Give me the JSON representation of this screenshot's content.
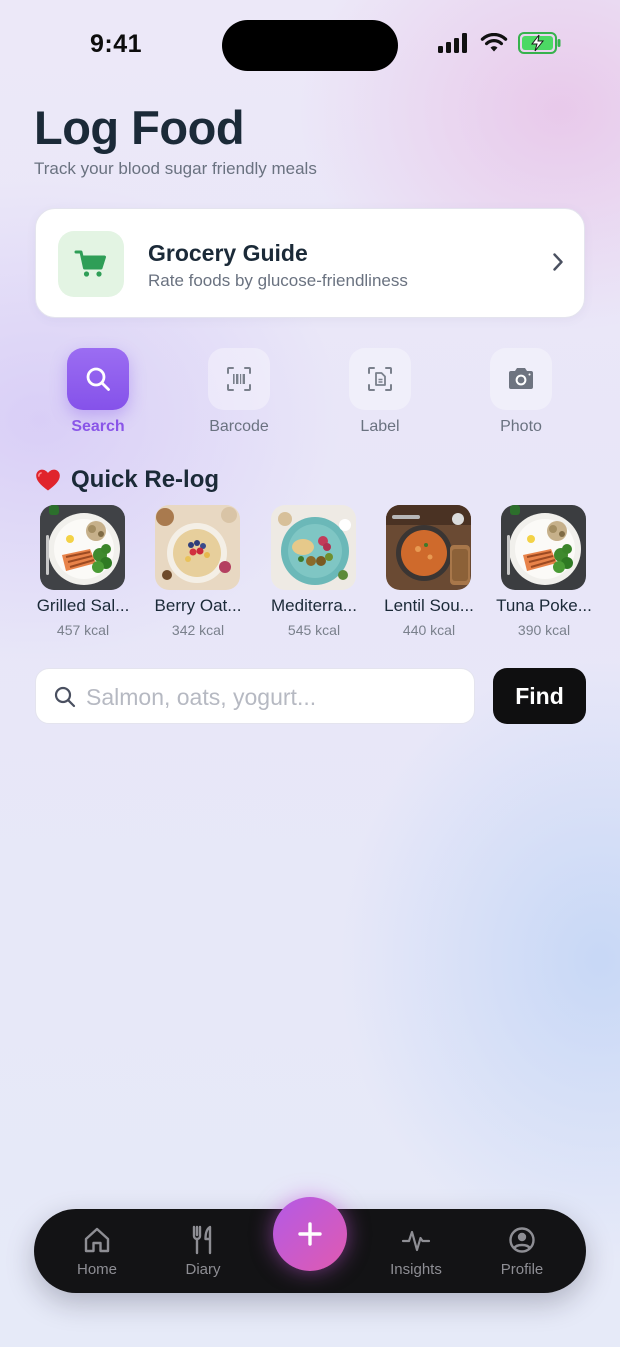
{
  "status_bar": {
    "time": "9:41"
  },
  "header": {
    "title": "Log Food",
    "subtitle": "Track your blood sugar friendly meals"
  },
  "grocery_card": {
    "title": "Grocery Guide",
    "subtitle": "Rate foods by glucose-friendliness",
    "icon": "cart-icon",
    "accent": "#2f9e57"
  },
  "modes": [
    {
      "label": "Search",
      "icon": "search-icon",
      "active": true
    },
    {
      "label": "Barcode",
      "icon": "barcode-icon",
      "active": false
    },
    {
      "label": "Label",
      "icon": "label-scan-icon",
      "active": false
    },
    {
      "label": "Photo",
      "icon": "camera-icon",
      "active": false
    }
  ],
  "quick_relog": {
    "title": "Quick Re-log",
    "icon": "heart-icon",
    "items": [
      {
        "name": "Grilled Sal...",
        "kcal": "457 kcal"
      },
      {
        "name": "Berry Oat...",
        "kcal": "342 kcal"
      },
      {
        "name": "Mediterra...",
        "kcal": "545 kcal"
      },
      {
        "name": "Lentil Sou...",
        "kcal": "440 kcal"
      },
      {
        "name": "Tuna Poke...",
        "kcal": "390 kcal"
      }
    ]
  },
  "search": {
    "placeholder": "Salmon, oats, yogurt...",
    "value": "",
    "button_label": "Find"
  },
  "bottom_nav": {
    "items": [
      {
        "label": "Home",
        "icon": "home-icon"
      },
      {
        "label": "Diary",
        "icon": "fork-knife-icon"
      },
      {
        "label": "Insights",
        "icon": "pulse-icon"
      },
      {
        "label": "Profile",
        "icon": "user-circle-icon"
      }
    ],
    "fab_icon": "plus-icon"
  },
  "colors": {
    "accent_purple": "#8a55e8",
    "title_text": "#1b2a38",
    "muted_text": "#6a7280",
    "nav_bg": "#131315",
    "fab_gradient_start": "#b35ae6",
    "fab_gradient_end": "#e05ab0"
  }
}
